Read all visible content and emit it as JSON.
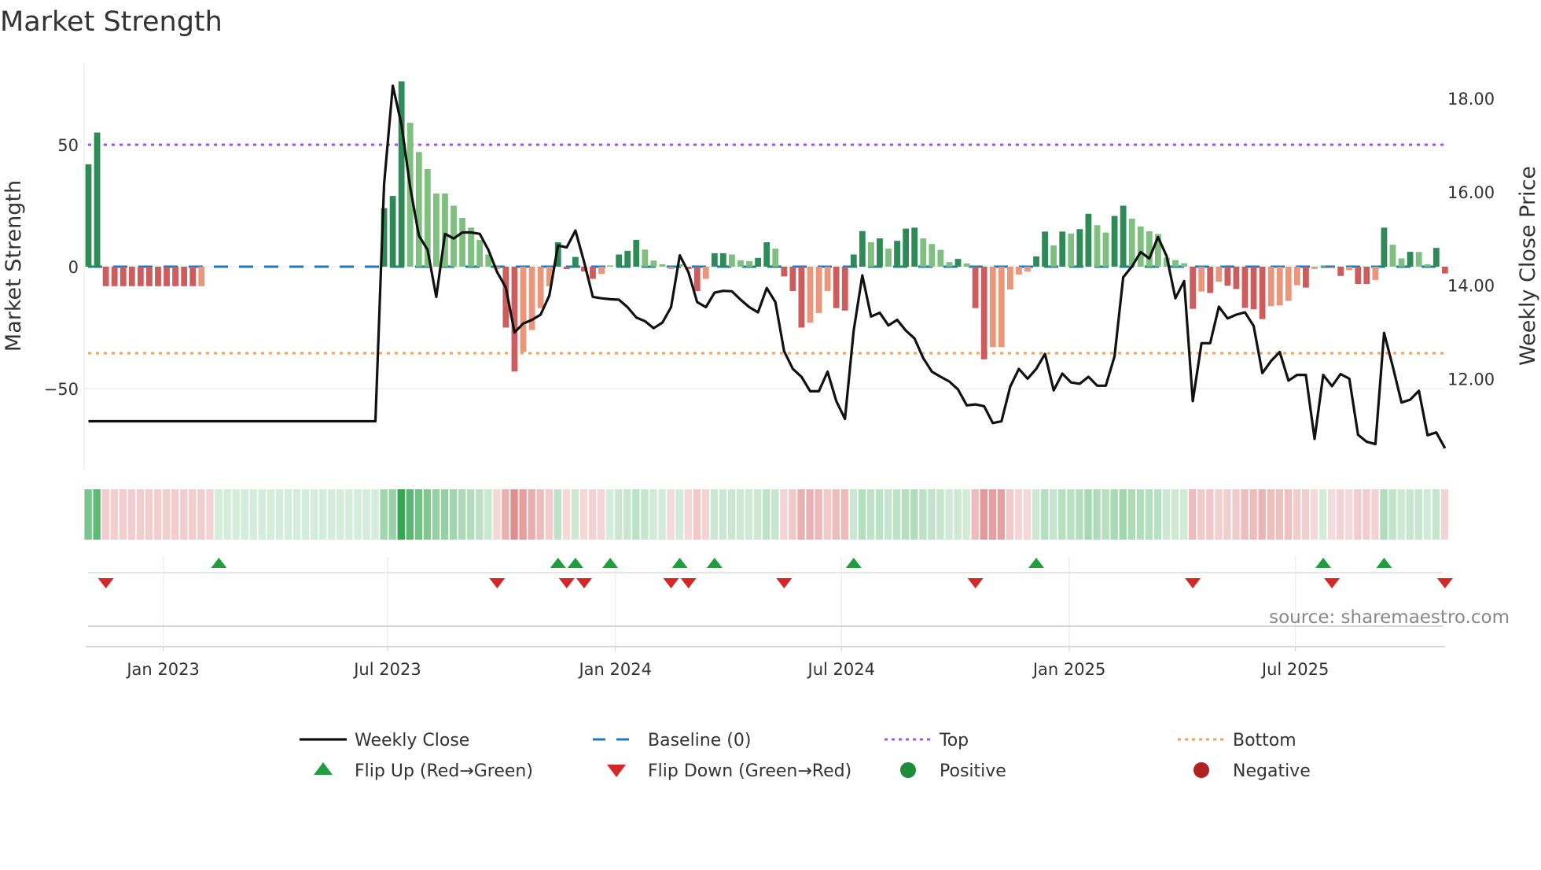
{
  "chart_data": {
    "type": "bar",
    "title": "Market Strength",
    "ylabel": "Market Strength",
    "y2label": "Weekly Close Price",
    "ylim": [
      -75,
      82
    ],
    "y2lim": [
      10.2,
      18.4
    ],
    "yticks": [
      50,
      0,
      -50
    ],
    "ytick_labels": [
      "50",
      "0",
      "−50"
    ],
    "y2ticks": [
      18,
      16,
      14,
      12
    ],
    "y2tick_labels": [
      "18.00",
      "16.00",
      "14.00",
      "12.00"
    ],
    "x_unit": "week index (weekly, ~Nov 2022 to Nov 2025)",
    "xticks": [
      {
        "week": 8.6,
        "label": "Jan 2023"
      },
      {
        "week": 34.4,
        "label": "Jul 2023"
      },
      {
        "week": 60.6,
        "label": "Jan 2024"
      },
      {
        "week": 86.6,
        "label": "Jul 2024"
      },
      {
        "week": 112.8,
        "label": "Jan 2025"
      },
      {
        "week": 138.8,
        "label": "Jul 2025"
      }
    ],
    "reference_lines": {
      "top": 50,
      "bottom": -35.5,
      "baseline": 0
    },
    "strength": [
      42,
      55,
      -8,
      -8,
      -8,
      -8,
      -8,
      -8,
      -8,
      -8,
      -8,
      -8,
      -8,
      -8,
      -4,
      0,
      0,
      0,
      0,
      0,
      0,
      0,
      0,
      0,
      0,
      0,
      0,
      0,
      0,
      0,
      0,
      0,
      0,
      0,
      24,
      29,
      76,
      59,
      47,
      40,
      30,
      30,
      25,
      20,
      16,
      11,
      5,
      -1,
      -25,
      -43,
      -35,
      -26,
      -17,
      -8,
      10,
      -1,
      4,
      -2,
      -5,
      -3,
      0.5,
      5,
      6.5,
      11,
      7,
      2.5,
      1,
      -1,
      1,
      -1,
      -10,
      -5,
      5.5,
      5.5,
      5,
      2.6,
      2.3,
      3.6,
      10,
      7.4,
      -4,
      -10,
      -25,
      -23,
      -19,
      -10,
      -17,
      -18,
      5,
      14.6,
      10,
      11.6,
      7.4,
      10.6,
      15.6,
      16,
      11.6,
      9.3,
      6.9,
      1.9,
      3.2,
      1.3,
      -17,
      -38,
      -33,
      -33,
      -9.4,
      -3.2,
      -2,
      4.2,
      14.4,
      8.7,
      14.4,
      13.6,
      15.4,
      21.7,
      17,
      14,
      20.8,
      25,
      19.7,
      16.5,
      14.5,
      13.4,
      3.7,
      2.7,
      1.4,
      -17.3,
      -10.2,
      -10.8,
      -6.2,
      -7.8,
      -9.2,
      -16.9,
      -17.5,
      -21.5,
      -16.2,
      -15.9,
      -14,
      -7.6,
      -8.6,
      -0.9,
      0.3,
      -0.5,
      -3.8,
      -1.4,
      -7.1,
      -7.1,
      -5.5,
      16,
      9,
      3.4,
      6.1,
      6,
      1,
      7.7,
      -2.8
    ],
    "shade": "DDRRRRRRRRRRRXZZZZZZZZZZZZZZZZZZZZDDDLLLLLLLLLLXRRXXXXDRDRRXLDDDLLLXLRRXDDLLLDDLRRRXXXRRDDLDLDDDLLLLDLRRXXXXXDDLDLDDLLDDLLLLLLLRXRXRRRRRXXXXRXLRRXRRXDLLDLLDR",
    "close": [
      11.09,
      11.09,
      11.09,
      11.09,
      11.09,
      11.09,
      11.09,
      11.09,
      11.09,
      11.09,
      11.09,
      11.09,
      11.09,
      11.09,
      11.09,
      11.09,
      11.09,
      11.09,
      11.09,
      11.09,
      11.09,
      11.09,
      11.09,
      11.09,
      11.09,
      11.09,
      11.09,
      11.09,
      11.09,
      11.09,
      11.09,
      11.09,
      11.09,
      11.09,
      16.16,
      18.27,
      17.43,
      16.1,
      15.06,
      14.76,
      13.75,
      15.1,
      15.0,
      15.13,
      15.13,
      15.1,
      14.75,
      14.28,
      13.95,
      12.99,
      13.18,
      13.26,
      13.37,
      13.78,
      14.85,
      14.81,
      15.17,
      14.5,
      13.75,
      13.72,
      13.7,
      13.69,
      13.53,
      13.31,
      13.23,
      13.08,
      13.2,
      13.53,
      14.64,
      14.28,
      13.64,
      13.53,
      13.84,
      13.88,
      13.87,
      13.69,
      13.53,
      13.42,
      13.94,
      13.64,
      12.59,
      12.21,
      12.04,
      11.73,
      11.73,
      12.15,
      11.52,
      11.14,
      13.03,
      14.21,
      13.33,
      13.41,
      13.14,
      13.26,
      13.03,
      12.86,
      12.44,
      12.15,
      12.04,
      11.94,
      11.77,
      11.43,
      11.45,
      11.41,
      11.05,
      11.09,
      11.83,
      12.21,
      12.0,
      12.21,
      12.53,
      11.75,
      12.11,
      11.92,
      11.89,
      12.04,
      11.85,
      11.85,
      12.48,
      14.17,
      14.4,
      14.71,
      14.57,
      15.03,
      14.62,
      13.72,
      14.09,
      11.52,
      12.76,
      12.76,
      13.54,
      13.29,
      13.37,
      13.42,
      13.13,
      12.12,
      12.38,
      12.57,
      11.96,
      12.08,
      12.08,
      10.71,
      12.08,
      11.84,
      12.1,
      12.0,
      10.8,
      10.65,
      10.6,
      12.98,
      12.26,
      11.49,
      11.55,
      11.74,
      10.79,
      10.85,
      10.51
    ],
    "flip_up": [
      15,
      54,
      56,
      60,
      68,
      72,
      88,
      109,
      142,
      149
    ],
    "flip_down": [
      2,
      47,
      55,
      57,
      67,
      69,
      80,
      102,
      127,
      143,
      156
    ],
    "colors": {
      "D": "#2e8b57",
      "L": "#7fbf7f",
      "R": "#cd5c5c",
      "X": "#e9967a",
      "close": "#111111",
      "baseline": "#1f77b4",
      "top": "#9b59e6",
      "bottom": "#f0a060",
      "up": "#1e9e3e",
      "down": "#d62728",
      "positive": "#1e8c3a",
      "negative": "#b22222"
    },
    "legend": {
      "placement": "bottom",
      "items": [
        {
          "key": "close",
          "label": "Weekly Close"
        },
        {
          "key": "baseline",
          "label": "Baseline (0)"
        },
        {
          "key": "top",
          "label": "Top"
        },
        {
          "key": "bottom",
          "label": "Bottom"
        },
        {
          "key": "up",
          "label": "Flip Up (Red→Green)"
        },
        {
          "key": "down",
          "label": "Flip Down (Green→Red)"
        },
        {
          "key": "positive",
          "label": "Positive"
        },
        {
          "key": "negative",
          "label": "Negative"
        }
      ]
    },
    "source": "source: sharemaestro.com"
  }
}
